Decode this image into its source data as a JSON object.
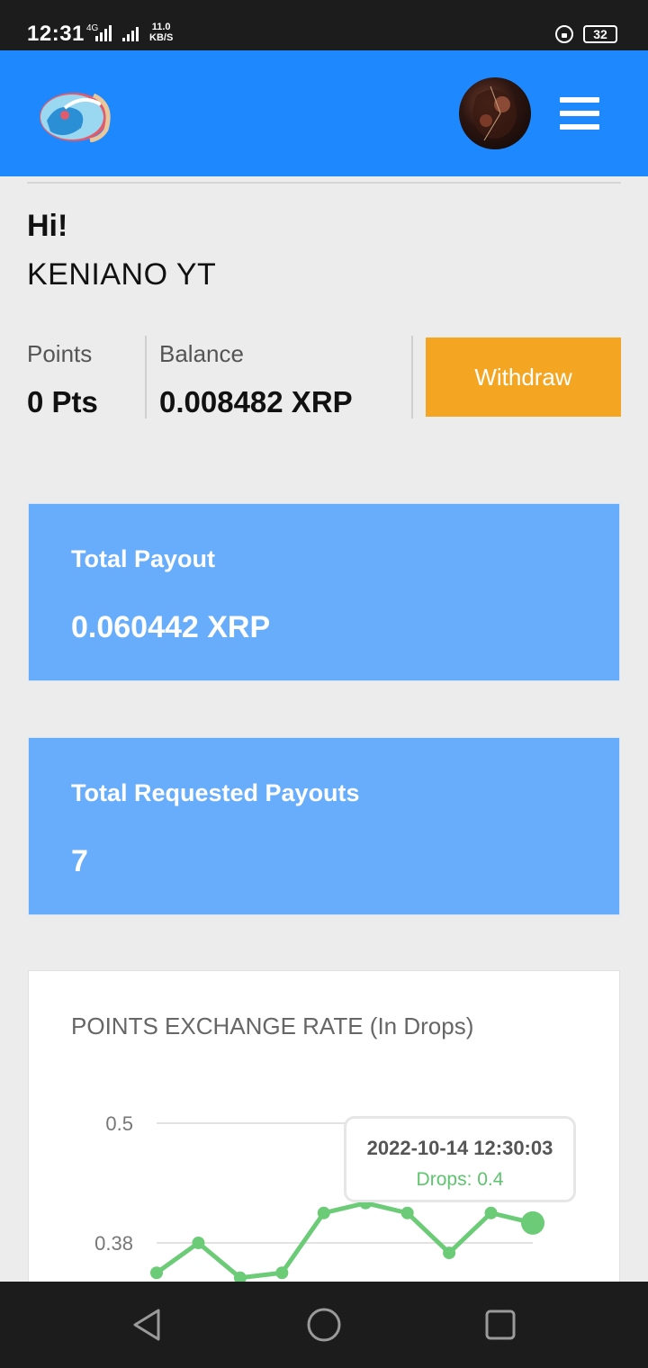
{
  "status_bar": {
    "time": "12:31",
    "network_1": "4G",
    "net_speed_value": "11.0",
    "net_speed_unit": "KB/S",
    "battery": "32"
  },
  "app_bar": {
    "logo_icon": "app-logo-icon",
    "avatar": "user-avatar",
    "menu_icon": "hamburger-menu-icon",
    "color": "#1e88ff"
  },
  "greeting": {
    "hi": "Hi!",
    "username": "KENIANO YT"
  },
  "stats": {
    "points_label": "Points",
    "points_value": "0 Pts",
    "balance_label": "Balance",
    "balance_value": "0.008482 XRP",
    "withdraw_label": "Withdraw",
    "withdraw_color": "#f4a623"
  },
  "cards": {
    "total_payout_title": "Total Payout",
    "total_payout_value": "0.060442 XRP",
    "total_requested_title": "Total Requested Payouts",
    "total_requested_value": "7",
    "card_color": "#68adfb"
  },
  "chart_data": {
    "type": "line",
    "title": "POINTS EXCHANGE RATE (In Drops)",
    "y_ticks": [
      "0.5",
      "0.38"
    ],
    "values": [
      0.35,
      0.38,
      0.345,
      0.35,
      0.41,
      0.42,
      0.41,
      0.37,
      0.41,
      0.4
    ],
    "line_color": "#6ccb77",
    "tooltip": {
      "date": "2022-10-14 12:30:03",
      "value_text": "Drops: 0.4"
    }
  },
  "nav_bar": {
    "back_icon": "back-triangle-icon",
    "home_icon": "home-circle-icon",
    "recents_icon": "recents-square-icon"
  }
}
